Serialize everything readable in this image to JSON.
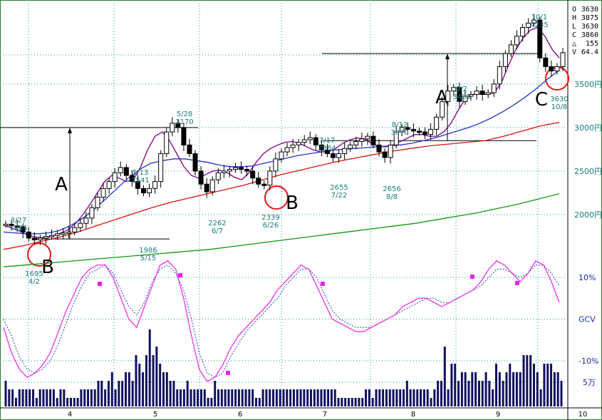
{
  "colors": {
    "frame": "#2d7a2d",
    "grid": "#1a9a9a",
    "up_candle": "#ffffff",
    "down_candle": "#000000",
    "ma_short": "#800080",
    "ma_mid": "#2233cc",
    "ma_long": "#dd1111",
    "ma_vlong": "#119911",
    "osc_main": "#ee22ee",
    "osc_signal": "#2244aa",
    "volume": "#101060",
    "circle": "#ee1111",
    "text_teal": "#1a7a7a",
    "text_blue": "#1a2aaa"
  },
  "info_panel": {
    "rows": [
      {
        "key": "O",
        "value": "3630"
      },
      {
        "key": "H",
        "value": "3875"
      },
      {
        "key": "L",
        "value": "3630"
      },
      {
        "key": "C",
        "value": "3860"
      },
      {
        "key": "△",
        "value": "155"
      },
      {
        "key": "V",
        "value": "64.4"
      }
    ]
  },
  "chart_data": [
    {
      "type": "candlestick",
      "ylim": [
        1500,
        4400
      ],
      "y_ticks": [
        {
          "value": 3500,
          "label": "3500円"
        },
        {
          "value": 3000,
          "label": "3000円"
        },
        {
          "value": 2500,
          "label": "2500円"
        },
        {
          "value": 2000,
          "label": "2000円"
        }
      ],
      "x_months": [
        "4",
        "5",
        "6",
        "7",
        "8",
        "9",
        "10"
      ],
      "annotations": [
        {
          "date": "3/27",
          "price": "1985"
        },
        {
          "date": "4/2",
          "price": "1695"
        },
        {
          "date": "5/13",
          "price": "2541"
        },
        {
          "date": "5/15",
          "price": "1986"
        },
        {
          "date": "5/28",
          "price": "3170"
        },
        {
          "date": "6/7",
          "price": "2262"
        },
        {
          "date": "6/26",
          "price": "2339"
        },
        {
          "date": "7/17",
          "price": "2884"
        },
        {
          "date": "7/22",
          "price": "2655"
        },
        {
          "date": "8/8",
          "price": "2656"
        },
        {
          "date": "8/12",
          "price": "3070"
        },
        {
          "date": "9/2",
          "price": "3460"
        },
        {
          "date": "10/1",
          "price": "4235"
        },
        {
          "date": "10/8",
          "price": "3630"
        }
      ],
      "pattern_labels": [
        "A",
        "B",
        "A",
        "B",
        "C"
      ],
      "series": [
        {
          "name": "candles",
          "close": [
            1890,
            1870,
            1860,
            1800,
            1730,
            1710,
            1730,
            1750,
            1760,
            1780,
            1790,
            1800,
            1850,
            1900,
            1960,
            2080,
            2200,
            2300,
            2380,
            2480,
            2541,
            2450,
            2380,
            2300,
            2250,
            2300,
            2380,
            2700,
            2950,
            3050,
            3000,
            2800,
            2700,
            2500,
            2350,
            2262,
            2400,
            2480,
            2500,
            2520,
            2540,
            2520,
            2500,
            2420,
            2350,
            2339,
            2500,
            2640,
            2720,
            2770,
            2800,
            2830,
            2860,
            2884,
            2800,
            2740,
            2700,
            2655,
            2700,
            2760,
            2800,
            2840,
            2870,
            2900,
            2800,
            2720,
            2656,
            2800,
            2950,
            3000,
            2980,
            2960,
            2950,
            2920,
            2980,
            3120,
            3300,
            3420,
            3460,
            3300,
            3360,
            3380,
            3420,
            3380,
            3400,
            3500,
            3700,
            3850,
            3950,
            4050,
            4150,
            4200,
            4235,
            3800,
            3700,
            3650,
            3700,
            3860
          ]
        },
        {
          "name": "ma_short",
          "values": [
            1880,
            1850,
            1820,
            1780,
            1750,
            1735,
            1740,
            1760,
            1790,
            1830,
            1900,
            2000,
            2120,
            2250,
            2380,
            2450,
            2420,
            2380,
            2400,
            2550,
            2750,
            2900,
            2950,
            2850,
            2700,
            2550,
            2450,
            2420,
            2460,
            2500,
            2510,
            2480,
            2430,
            2400,
            2480,
            2600,
            2700,
            2760,
            2800,
            2830,
            2840,
            2820,
            2780,
            2740,
            2720,
            2720,
            2760,
            2820,
            2860,
            2880,
            2870,
            2820,
            2780,
            2780,
            2800,
            2840,
            2880,
            2920,
            2920,
            2900,
            2900,
            2950,
            3050,
            3200,
            3330,
            3380,
            3390,
            3380,
            3400,
            3520,
            3720,
            3900,
            4030,
            4120,
            4150,
            4050,
            3900,
            3800
          ]
        },
        {
          "name": "ma_mid",
          "values": [
            1800,
            1790,
            1780,
            1780,
            1790,
            1820,
            1880,
            1960,
            2060,
            2180,
            2300,
            2420,
            2520,
            2590,
            2620,
            2640,
            2640,
            2620,
            2600,
            2570,
            2550,
            2550,
            2560,
            2590,
            2620,
            2650,
            2680,
            2700,
            2720,
            2740,
            2750,
            2760,
            2770,
            2780,
            2790,
            2800,
            2820,
            2850,
            2880,
            2920,
            2960,
            3000,
            3050,
            3110,
            3180,
            3260,
            3350,
            3450,
            3560,
            3660
          ]
        },
        {
          "name": "ma_long",
          "values": [
            1600,
            1640,
            1690,
            1740,
            1800,
            1870,
            1940,
            2010,
            2080,
            2140,
            2190,
            2240,
            2290,
            2340,
            2400,
            2460,
            2510,
            2560,
            2610,
            2650,
            2690,
            2730,
            2760,
            2790,
            2810,
            2830,
            2850,
            2900,
            2960,
            3020,
            3060
          ]
        },
        {
          "name": "ma_vlong",
          "values": [
            1400,
            1420,
            1440,
            1460,
            1480,
            1500,
            1520,
            1540,
            1560,
            1580,
            1600,
            1630,
            1660,
            1690,
            1720,
            1750,
            1780,
            1810,
            1840,
            1870,
            1900,
            1940,
            1980,
            2020,
            2070,
            2120,
            2180,
            2240
          ]
        }
      ],
      "horizontal_lines": [
        {
          "from_month": "3",
          "to_month": "5",
          "price": 3000
        },
        {
          "from_month": "3",
          "to_month": "5",
          "price": 1720
        },
        {
          "from_month": "7",
          "to_month": "9",
          "price": 3850
        },
        {
          "from_month": "7",
          "to_month": "9",
          "price": 2850
        }
      ]
    },
    {
      "type": "line",
      "title": "",
      "y_ticks": [
        {
          "value": 10,
          "label": "10%"
        },
        {
          "value": 0,
          "label": "GCV"
        },
        {
          "value": -10,
          "label": "-10%"
        }
      ],
      "ylim": [
        -15,
        15
      ],
      "series": [
        {
          "name": "main",
          "values": [
            -2,
            -8,
            -12,
            -14,
            -13,
            -11,
            -8,
            -3,
            2,
            6,
            10,
            12,
            13,
            13,
            10,
            5,
            0,
            -2,
            3,
            8,
            13,
            14,
            12,
            5,
            -4,
            -12,
            -15,
            -14,
            -11,
            -7,
            -4,
            -2,
            0,
            2,
            4,
            7,
            9,
            11,
            13,
            12,
            8,
            4,
            0,
            -1,
            -2,
            -3,
            -3,
            -2,
            -1,
            0,
            1,
            3,
            4,
            5,
            5,
            4,
            3,
            4,
            5,
            6,
            7,
            9,
            12,
            14,
            13,
            11,
            9,
            11,
            14,
            13,
            9,
            4
          ]
        },
        {
          "name": "signal",
          "values": [
            0,
            -4,
            -9,
            -12,
            -13,
            -12,
            -10,
            -6,
            -1,
            4,
            8,
            11,
            12,
            13,
            11,
            7,
            3,
            1,
            4,
            9,
            12,
            13,
            11,
            7,
            0,
            -8,
            -13,
            -14,
            -13,
            -9,
            -6,
            -3,
            -1,
            1,
            3,
            5,
            8,
            10,
            12,
            12,
            10,
            6,
            2,
            0,
            -1,
            -2,
            -2,
            -2,
            -1,
            0,
            1,
            2,
            3,
            4,
            5,
            5,
            4,
            4,
            5,
            6,
            7,
            8,
            10,
            12,
            12,
            11,
            10,
            11,
            13,
            13,
            11,
            8
          ]
        }
      ]
    },
    {
      "type": "bar",
      "y_ticks": [
        {
          "value": 5,
          "label": "5万"
        }
      ],
      "values": [
        3,
        2,
        2,
        1,
        2,
        2,
        2,
        2,
        2,
        1,
        2,
        2,
        2,
        2,
        2,
        1,
        2,
        2,
        1,
        1,
        1,
        1,
        2,
        2,
        2,
        2,
        2,
        3,
        3,
        2,
        3,
        4,
        2,
        3,
        3,
        4,
        4,
        3,
        6,
        5,
        4,
        6,
        9,
        6,
        7,
        5,
        4,
        4,
        3,
        3,
        2,
        2,
        2,
        3,
        2,
        2,
        2,
        2,
        2,
        1,
        1,
        3,
        2,
        2,
        2,
        2,
        2,
        2,
        2,
        2,
        2,
        2,
        2,
        1,
        1,
        2,
        2,
        2,
        2,
        2,
        2,
        2,
        2,
        2,
        2,
        2,
        2,
        2,
        2,
        2,
        2,
        2,
        2,
        2,
        2,
        2,
        2,
        1,
        1,
        1,
        1,
        1,
        1,
        1,
        1,
        2,
        2,
        1,
        2,
        2,
        2,
        2,
        2,
        2,
        2,
        2,
        2,
        3,
        2,
        2,
        2,
        2,
        2,
        2,
        1,
        2,
        3,
        3,
        7,
        2,
        5,
        5,
        3,
        4,
        4,
        3,
        4,
        4,
        3,
        3,
        4,
        3,
        2,
        5,
        4,
        3,
        4,
        5,
        4,
        4,
        4,
        6,
        6,
        6,
        5,
        4,
        2,
        5,
        5,
        5,
        4,
        4,
        3
      ]
    }
  ]
}
